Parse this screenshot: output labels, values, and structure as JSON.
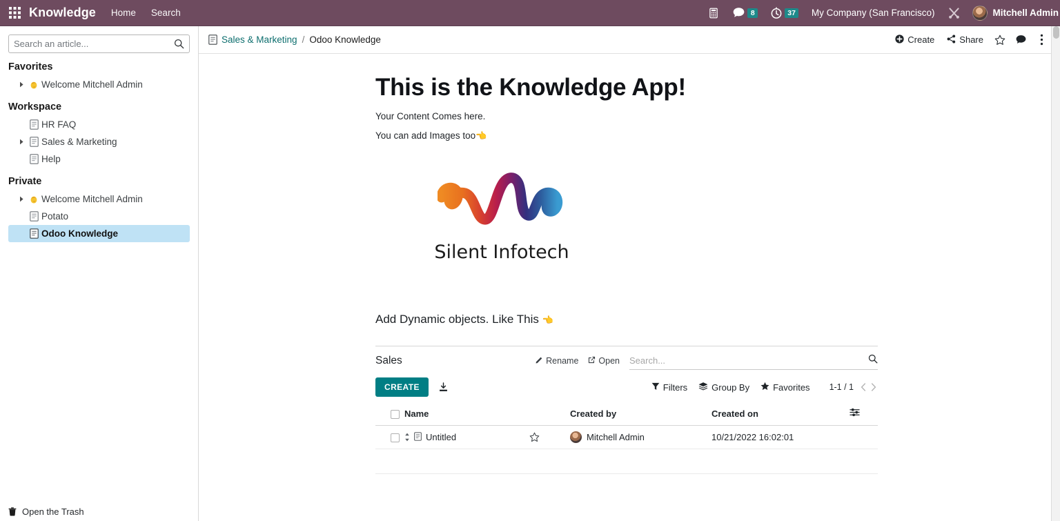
{
  "navbar": {
    "apps_icon": "apps-grid-icon",
    "brand": "Knowledge",
    "menu": [
      {
        "label": "Home"
      },
      {
        "label": "Search"
      }
    ],
    "voip_icon": "phone-icon",
    "messages_icon": "chat-bubble-icon",
    "messages_count": "8",
    "activities_icon": "clock-icon",
    "activities_count": "37",
    "company": "My Company (San Francisco)",
    "debug_icon": "tools-icon",
    "user_name": "Mitchell Admin",
    "avatar": "user-avatar",
    "bg_color": "#6e4b5f",
    "badge_color": "#1d8a8a"
  },
  "sidebar": {
    "search_placeholder": "Search an article...",
    "search_value": "",
    "search_icon": "magnifier-icon",
    "sections": [
      {
        "title": "Favorites",
        "items": [
          {
            "label": "Welcome Mitchell Admin",
            "icon": "waving-hand-emoji",
            "caret": true,
            "selected": false
          }
        ]
      },
      {
        "title": "Workspace",
        "items": [
          {
            "label": "HR FAQ",
            "icon": "document-icon",
            "caret": false,
            "selected": false
          },
          {
            "label": "Sales & Marketing",
            "icon": "document-icon",
            "caret": true,
            "selected": false
          },
          {
            "label": "Help",
            "icon": "document-icon",
            "caret": false,
            "selected": false
          }
        ]
      },
      {
        "title": "Private",
        "items": [
          {
            "label": "Welcome Mitchell Admin",
            "icon": "waving-hand-emoji",
            "caret": true,
            "selected": false
          },
          {
            "label": "Potato",
            "icon": "document-icon",
            "caret": false,
            "selected": false
          },
          {
            "label": "Odoo Knowledge",
            "icon": "document-icon",
            "caret": false,
            "selected": true
          }
        ]
      }
    ],
    "trash_label": "Open the Trash",
    "trash_icon": "trash-icon",
    "selected_bg": "#bfe2f5"
  },
  "control_panel": {
    "breadcrumb_icon": "document-icon",
    "breadcrumb_parent": "Sales & Marketing",
    "breadcrumb_sep": "/",
    "breadcrumb_current": "Odoo Knowledge",
    "create_label": "Create",
    "create_icon": "plus-circle-icon",
    "share_label": "Share",
    "share_icon": "share-icon",
    "favorite_icon": "star-outline-icon",
    "chatter_icon": "chat-bubble-icon",
    "more_icon": "vertical-dots-icon",
    "link_color": "#0d6e6e"
  },
  "document": {
    "title": "This is the Knowledge App!",
    "paragraph_1": "Your Content Comes here.",
    "paragraph_2": "You can add Images too",
    "paragraph_2_emoji": "👈",
    "logo_alt": "silent-infotech-logo",
    "logo_text": "Silent Infotech",
    "dynamic_text": "Add Dynamic objects. Like This",
    "dynamic_emoji": "👈",
    "logo_colors": [
      "#ef8a23",
      "#d8422e",
      "#b91e4b",
      "#7b1f6a",
      "#2d2e83",
      "#3a9bd1"
    ]
  },
  "embedded_view": {
    "title": "Sales",
    "rename_label": "Rename",
    "rename_icon": "pencil-icon",
    "open_label": "Open",
    "open_icon": "external-link-icon",
    "search_placeholder": "Search...",
    "search_value": "",
    "search_icon": "magnifier-icon",
    "create_label": "CREATE",
    "create_color": "#017e84",
    "download_icon": "download-icon",
    "filters_label": "Filters",
    "filters_icon": "funnel-icon",
    "groupby_label": "Group By",
    "groupby_icon": "layers-icon",
    "favorites_label": "Favorites",
    "favorites_icon": "star-icon",
    "pager": "1-1 / 1",
    "pager_prev_icon": "chevron-left-icon",
    "pager_next_icon": "chevron-right-icon",
    "columns": [
      "Name",
      "Created by",
      "Created on"
    ],
    "settings_icon": "column-settings-icon",
    "rows": [
      {
        "checkbox": false,
        "drag_icon": "drag-handle-icon",
        "doc_icon": "document-icon",
        "name": "Untitled",
        "star_icon": "star-outline-icon",
        "created_by": "Mitchell Admin",
        "created_by_avatar": "user-avatar",
        "created_on": "10/21/2022 16:02:01"
      }
    ]
  },
  "scrollbar": {
    "up_icon": "caret-up-icon"
  }
}
